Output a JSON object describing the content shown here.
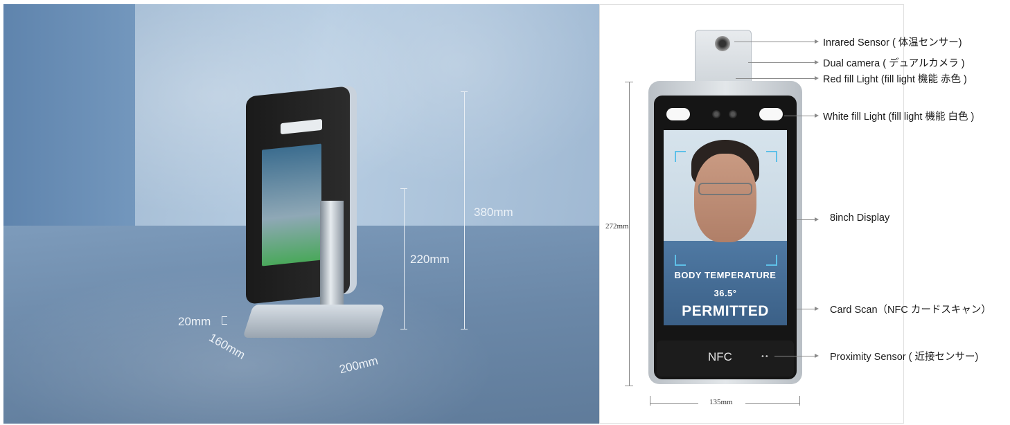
{
  "photo": {
    "dimensions": {
      "height_total": "380mm",
      "height_pole": "220mm",
      "base_thickness": "20mm",
      "base_depth": "160mm",
      "base_width": "200mm"
    }
  },
  "diagram": {
    "callouts": {
      "infrared_sensor": "Inrared Sensor ( 体温センサー)",
      "dual_camera": "Dual camera ( デュアルカメラ )",
      "red_fill_light": "Red fill Light (fill light 機能 赤色 )",
      "white_fill_light": "White fill Light (fill light 機能 白色 )",
      "display": "8inch Display",
      "card_scan": "Card Scan（NFC カードスキャン）",
      "proximity_sensor": "Proximity Sensor ( 近接センサー)"
    },
    "screen": {
      "line1": "BODY TEMPERATURE",
      "line2": "36.5°",
      "line3": "PERMITTED"
    },
    "nfc_label": "NFC",
    "dimensions": {
      "height": "272mm",
      "width": "135mm"
    }
  },
  "colors": {
    "callout_line": "#8a8a8a",
    "screen_frame_accent": "#5ec0e8",
    "device_black": "#151515"
  }
}
